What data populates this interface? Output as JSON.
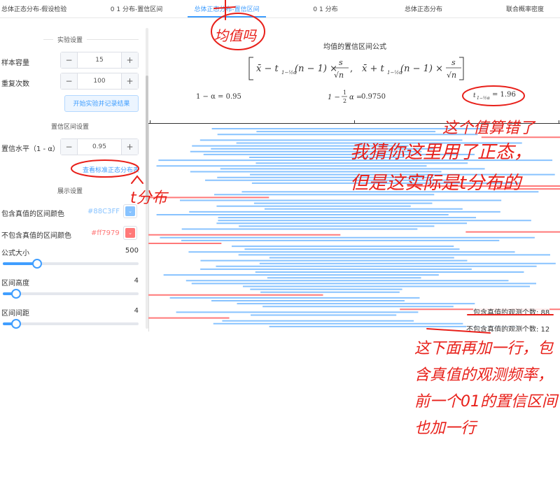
{
  "tabs": [
    {
      "label": "总体正态分布-假设检验"
    },
    {
      "label": "0 1 分布-置信区间"
    },
    {
      "label": "总体正态分布-置信区间"
    },
    {
      "label": "0 1 分布"
    },
    {
      "label": "总体正态分布"
    },
    {
      "label": "联合概率密度"
    }
  ],
  "sidebar": {
    "experiment_heading": "实验设置",
    "sample_size_label": "样本容量",
    "sample_size_value": "15",
    "repeat_label": "重复次数",
    "repeat_value": "100",
    "run_button": "开始实验并记录结果",
    "ci_heading": "置信区间设置",
    "confidence_label": "置信水平（1 - α）",
    "confidence_value": "0.95",
    "table_link": "查看标准正态分布表",
    "display_heading": "展示设置",
    "contain_color_label": "包含真值的区间颜色",
    "contain_color_value": "#88C3FF",
    "exclude_color_label": "不包含真值的区间颜色",
    "exclude_color_value": "#ff7979",
    "font_size_label": "公式大小",
    "font_size_value": "500",
    "font_size_level": 0.25,
    "interval_height_label": "区间高度",
    "interval_height_value": "4",
    "interval_height_level": 0.1,
    "interval_gap_label": "区间间距",
    "interval_gap_value": "4",
    "interval_gap_level": 0.1
  },
  "main": {
    "formula_title": "均值的置信区间公式",
    "alpha_text": "1 − α = 0.95",
    "half_alpha_text": "0.9750",
    "t_value": "= 1.96",
    "count_contain_label": "包含真值的观测个数: 88",
    "count_exclude_label": "不包含真值的观测个数: 12"
  },
  "colors": {
    "accent": "#409eff",
    "contain": "#88C3FF",
    "exclude": "#ff7979"
  },
  "annotations": [
    "均值吗",
    "这个值算错了",
    "我猜你这里用了正态，但是这实际是t分布的",
    "t分布",
    "这下面再加一行，包含真值的观测频率，前一个01的置信区间也加一行"
  ]
}
